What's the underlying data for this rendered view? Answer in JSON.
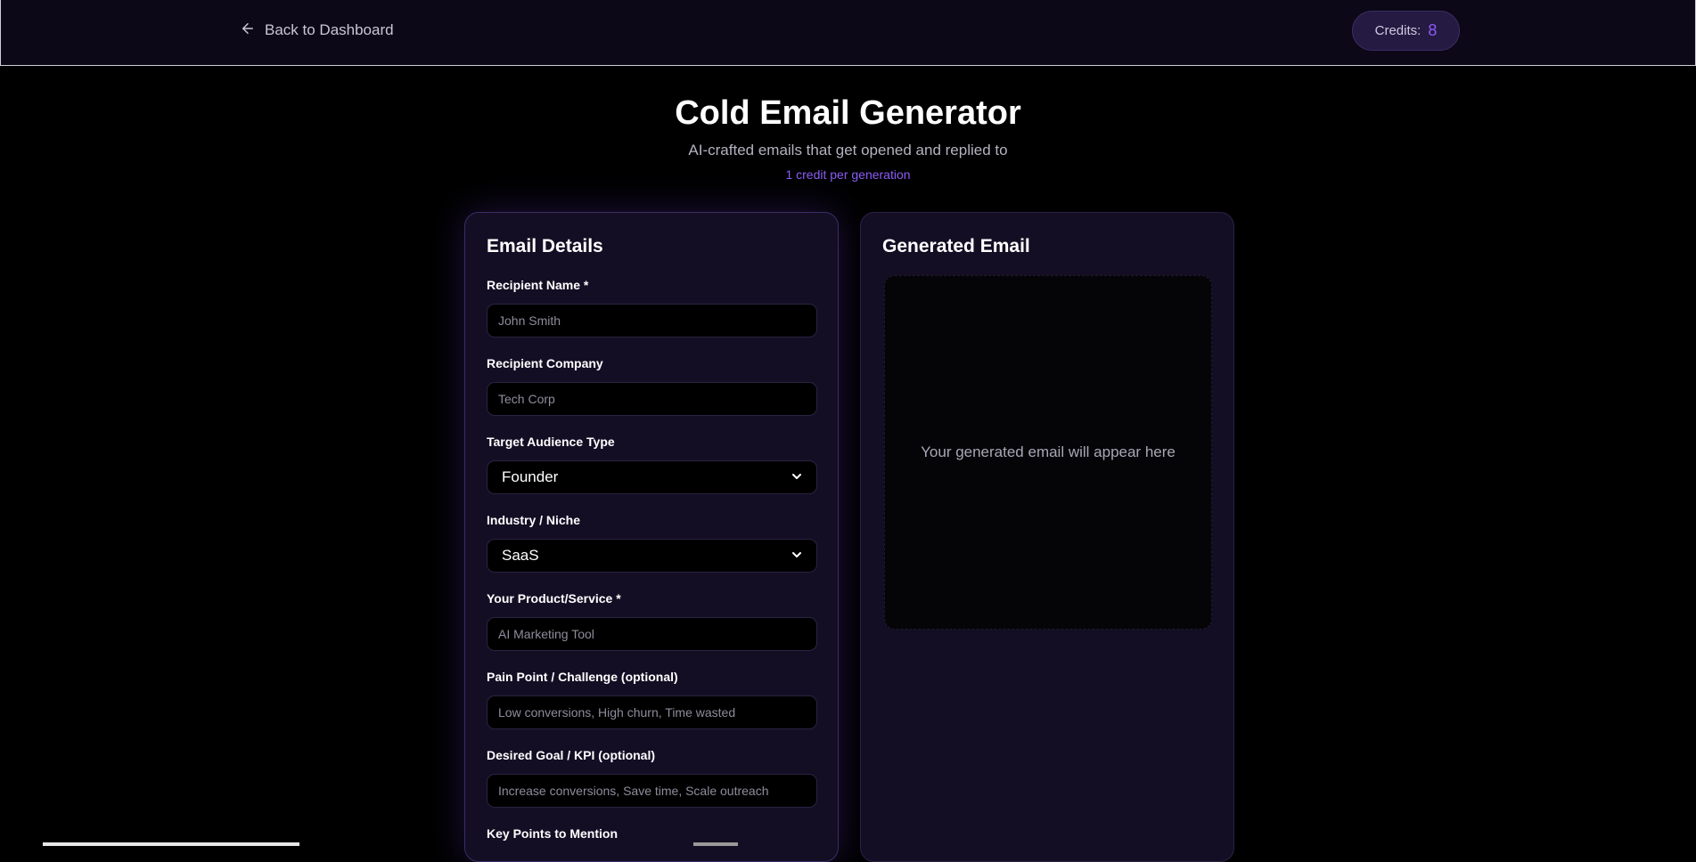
{
  "header": {
    "back_label": "Back to Dashboard",
    "credits_label": "Credits:",
    "credits_value": "8"
  },
  "hero": {
    "title": "Cold Email Generator",
    "subtitle": "AI-crafted emails that get opened and replied to",
    "cost_note": "1 credit per generation"
  },
  "form": {
    "title": "Email Details",
    "recipient_name": {
      "label": "Recipient Name *",
      "placeholder": "John Smith"
    },
    "recipient_company": {
      "label": "Recipient Company",
      "placeholder": "Tech Corp"
    },
    "audience_type": {
      "label": "Target Audience Type",
      "value": "Founder"
    },
    "industry": {
      "label": "Industry / Niche",
      "value": "SaaS"
    },
    "product": {
      "label": "Your Product/Service *",
      "placeholder": "AI Marketing Tool"
    },
    "pain_point": {
      "label": "Pain Point / Challenge (optional)",
      "placeholder": "Low conversions, High churn, Time wasted"
    },
    "goal": {
      "label": "Desired Goal / KPI (optional)",
      "placeholder": "Increase conversions, Save time, Scale outreach"
    },
    "key_points": {
      "label": "Key Points to Mention"
    }
  },
  "output": {
    "title": "Generated Email",
    "empty_message": "Your generated email will appear here"
  },
  "colors": {
    "accent": "#8b5cf6",
    "panel_bg": "#140e24",
    "page_bg": "#000000"
  }
}
